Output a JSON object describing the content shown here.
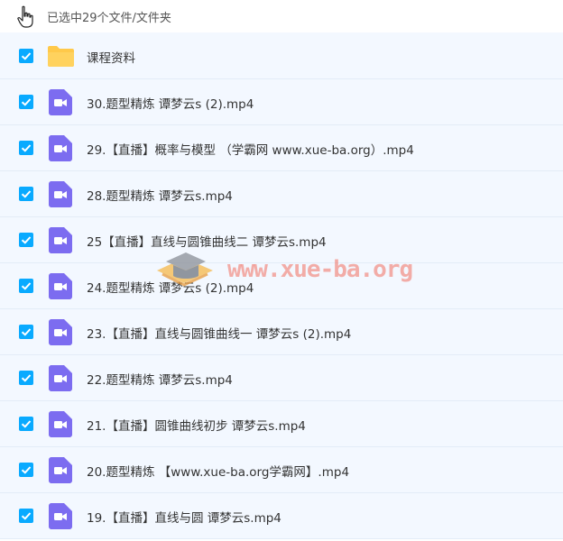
{
  "header": {
    "selection_text": "已选中29个文件/文件夹"
  },
  "files": [
    {
      "name": "课程资料",
      "type": "folder"
    },
    {
      "name": "30.题型精炼 谭梦云s (2).mp4",
      "type": "video"
    },
    {
      "name": "29.【直播】概率与模型 （学霸网 www.xue-ba.org）.mp4",
      "type": "video"
    },
    {
      "name": "28.题型精炼 谭梦云s.mp4",
      "type": "video"
    },
    {
      "name": "25【直播】直线与圆锥曲线二 谭梦云s.mp4",
      "type": "video"
    },
    {
      "name": "24.题型精炼 谭梦云s (2).mp4",
      "type": "video"
    },
    {
      "name": "23.【直播】直线与圆锥曲线一 谭梦云s (2).mp4",
      "type": "video"
    },
    {
      "name": "22.题型精炼 谭梦云s.mp4",
      "type": "video"
    },
    {
      "name": "21.【直播】圆锥曲线初步 谭梦云s.mp4",
      "type": "video"
    },
    {
      "name": "20.题型精炼 【www.xue-ba.org学霸网】.mp4",
      "type": "video"
    },
    {
      "name": "19.【直播】直线与圆 谭梦云s.mp4",
      "type": "video"
    }
  ],
  "watermark": {
    "text": "www.xue-ba.org"
  },
  "colors": {
    "checkbox": "#09aaff",
    "video_icon": "#7c6cf0",
    "folder_icon": "#ffc94a",
    "row_bg": "#f3f8ff"
  }
}
